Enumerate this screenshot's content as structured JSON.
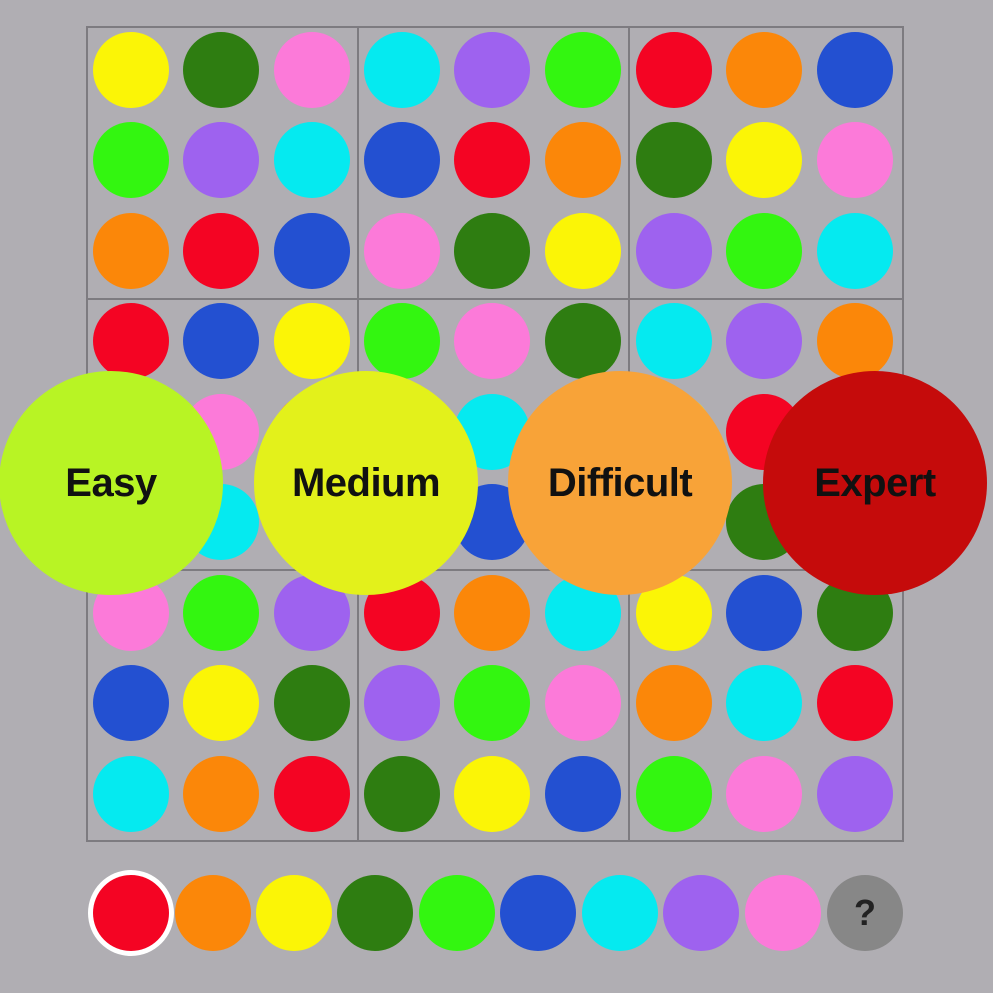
{
  "colors": {
    "red": "#f40423",
    "orange": "#fb8709",
    "yellow": "#fbf506",
    "darkgreen": "#2e7d11",
    "green": "#33f610",
    "blue": "#2350d1",
    "cyan": "#05eaf0",
    "purple": "#9e62ef",
    "pink": "#fc7ad9",
    "help_bg": "#878787"
  },
  "grid": [
    [
      "yellow",
      "darkgreen",
      "pink",
      "cyan",
      "purple",
      "green",
      "red",
      "orange",
      "blue"
    ],
    [
      "green",
      "purple",
      "cyan",
      "blue",
      "red",
      "orange",
      "darkgreen",
      "yellow",
      "pink"
    ],
    [
      "orange",
      "red",
      "blue",
      "pink",
      "darkgreen",
      "yellow",
      "purple",
      "green",
      "cyan"
    ],
    [
      "red",
      "blue",
      "yellow",
      "green",
      "pink",
      "darkgreen",
      "cyan",
      "purple",
      "orange"
    ],
    [
      "darkgreen",
      "pink",
      "orange",
      "purple",
      "cyan",
      "red",
      "yellow",
      "red",
      "blue"
    ],
    [
      "purple",
      "cyan",
      "green",
      "orange",
      "blue",
      "yellow",
      "pink",
      "darkgreen",
      "yellow"
    ],
    [
      "pink",
      "green",
      "purple",
      "red",
      "orange",
      "cyan",
      "yellow",
      "blue",
      "darkgreen"
    ],
    [
      "blue",
      "yellow",
      "darkgreen",
      "purple",
      "green",
      "pink",
      "orange",
      "cyan",
      "red"
    ],
    [
      "cyan",
      "orange",
      "red",
      "darkgreen",
      "yellow",
      "blue",
      "green",
      "pink",
      "purple"
    ]
  ],
  "palette": {
    "selected": "red",
    "swatches": [
      "red",
      "orange",
      "yellow",
      "darkgreen",
      "green",
      "blue",
      "cyan",
      "purple",
      "pink"
    ],
    "help_label": "?"
  },
  "levels": [
    {
      "id": "easy",
      "label": "Easy",
      "color": "#b8f424"
    },
    {
      "id": "medium",
      "label": "Medium",
      "color": "#e3f11b"
    },
    {
      "id": "difficult",
      "label": "Difficult",
      "color": "#f8a338"
    },
    {
      "id": "expert",
      "label": "Expert",
      "color": "#c50b0b"
    }
  ]
}
